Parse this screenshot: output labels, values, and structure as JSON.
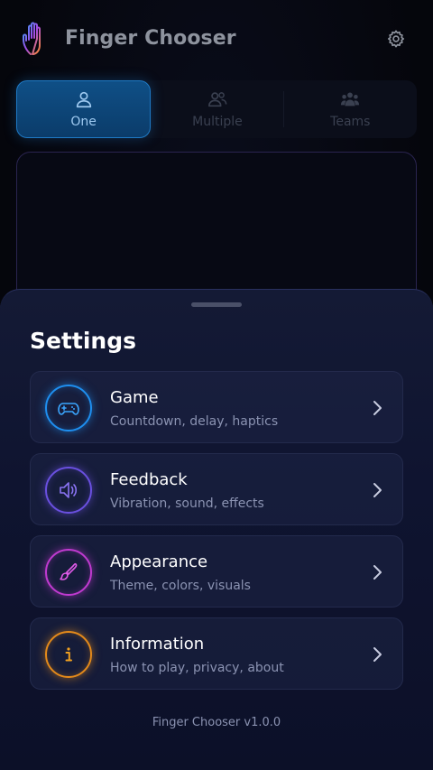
{
  "header": {
    "title": "Finger Chooser",
    "logo_icon": "hand-icon",
    "settings_icon": "gear-icon"
  },
  "modes": [
    {
      "label": "One",
      "icon": "person-icon",
      "active": true
    },
    {
      "label": "Multiple",
      "icon": "people-icon",
      "active": false
    },
    {
      "label": "Teams",
      "icon": "team-icon",
      "active": false
    }
  ],
  "settings": {
    "title": "Settings",
    "items": [
      {
        "title": "Game",
        "subtitle": "Countdown, delay, haptics",
        "icon": "gamepad-icon",
        "color": "#1e8ff0"
      },
      {
        "title": "Feedback",
        "subtitle": "Vibration, sound, effects",
        "icon": "speaker-icon",
        "color": "#6a50e0"
      },
      {
        "title": "Appearance",
        "subtitle": "Theme, colors, visuals",
        "icon": "brush-icon",
        "color": "#c03ad0"
      },
      {
        "title": "Information",
        "subtitle": "How to play, privacy, about",
        "icon": "info-icon",
        "color": "#e58a1a"
      }
    ],
    "version": "Finger Chooser v1.0.0"
  }
}
